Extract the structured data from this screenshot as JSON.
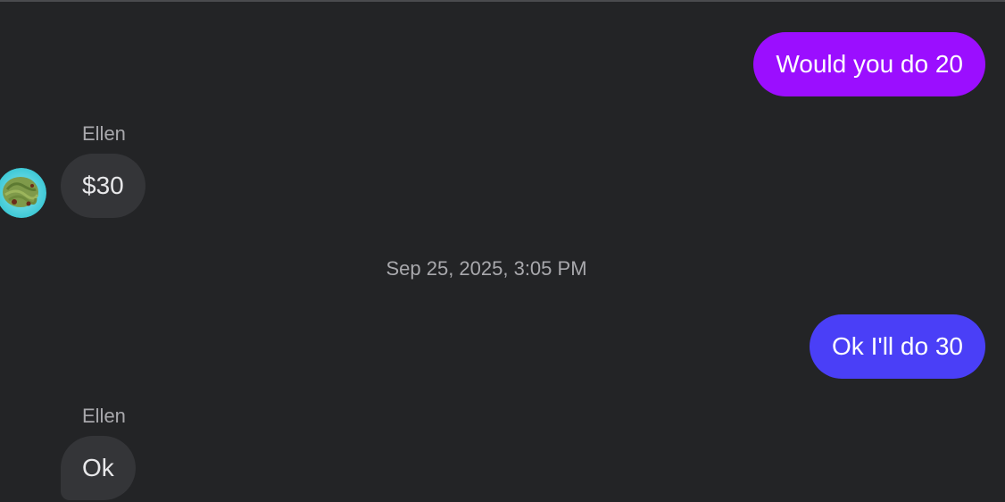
{
  "messages": [
    {
      "direction": "outgoing",
      "text": "Would you do 20",
      "color": "#9b0eff"
    },
    {
      "direction": "incoming",
      "sender": "Ellen",
      "text": "$30"
    },
    {
      "direction": "outgoing",
      "text": "Ok I'll do 30",
      "color": "#4a3ff7"
    },
    {
      "direction": "incoming",
      "sender": "Ellen",
      "text": "Ok"
    }
  ],
  "timestamp": "Sep 25, 2025, 3:05 PM",
  "colors": {
    "background": "#232426",
    "incoming_bubble": "#343538",
    "muted_text": "#a8a8ac"
  },
  "avatar_icon": "food-photo-avatar"
}
